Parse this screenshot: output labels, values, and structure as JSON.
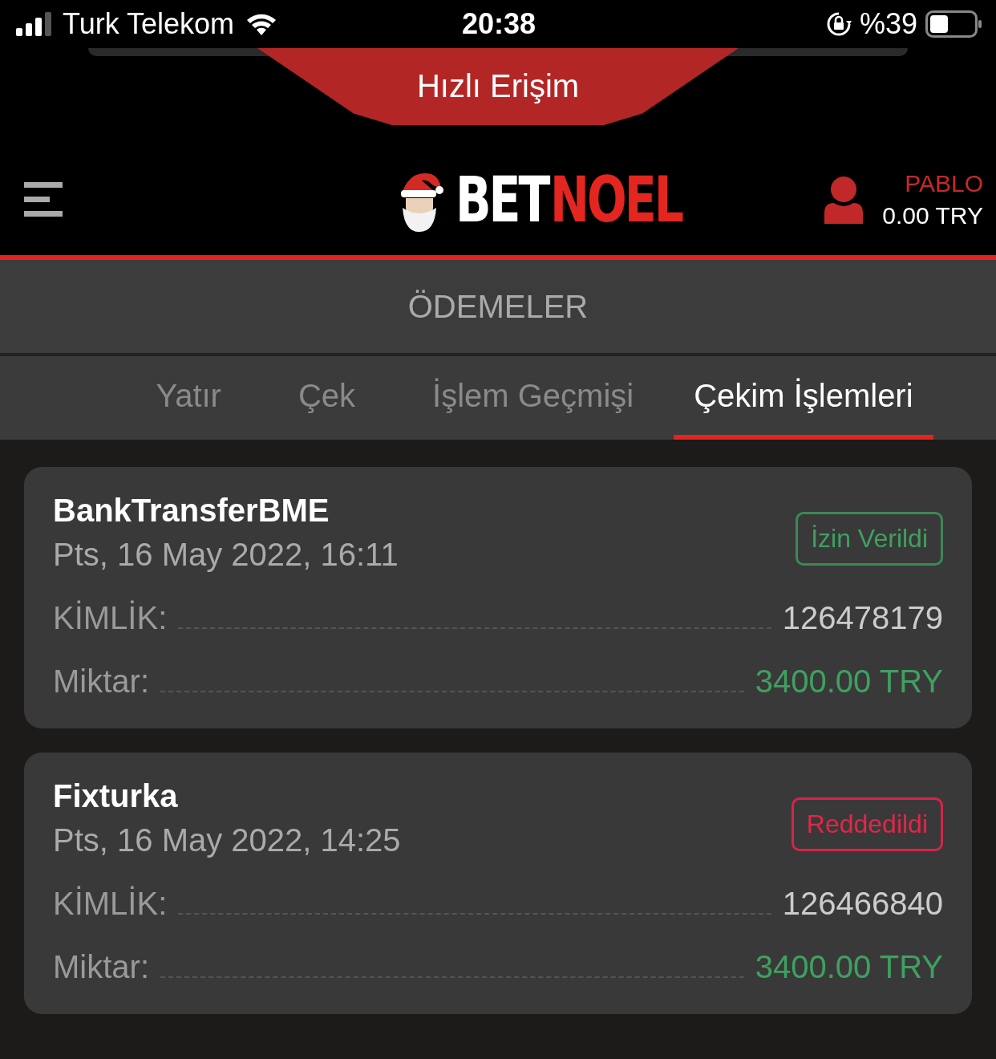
{
  "status_bar": {
    "carrier": "Turk Telekom",
    "time": "20:38",
    "battery": "%39"
  },
  "quick_access": {
    "label": "Hızlı Erişim"
  },
  "header": {
    "logo": [
      "BET",
      "NOEL"
    ],
    "user": {
      "name": "PABLO",
      "balance": "0.00 TRY"
    }
  },
  "page_title": "ÖDEMELER",
  "tabs": [
    {
      "label": "Yatır",
      "selected": false
    },
    {
      "label": "Çek",
      "selected": false
    },
    {
      "label": "İşlem Geçmişi",
      "selected": false
    },
    {
      "label": "Çekim İşlemleri",
      "selected": true
    }
  ],
  "withdrawals": [
    {
      "method": "BankTransferBME",
      "date": "Pts, 16 May 2022, 16:11",
      "status": {
        "label": "İzin Verildi",
        "kind": "approved"
      },
      "fields": [
        {
          "label": "KİMLİK:",
          "value": "126478179",
          "kind": "plain"
        },
        {
          "label": "Miktar:",
          "value": "3400.00 TRY",
          "kind": "amount"
        }
      ]
    },
    {
      "method": "Fixturka",
      "date": "Pts, 16 May 2022, 14:25",
      "status": {
        "label": "Reddedildi",
        "kind": "rejected"
      },
      "fields": [
        {
          "label": "KİMLİK:",
          "value": "126466840",
          "kind": "plain"
        },
        {
          "label": "Miktar:",
          "value": "3400.00 TRY",
          "kind": "amount"
        }
      ]
    }
  ]
}
